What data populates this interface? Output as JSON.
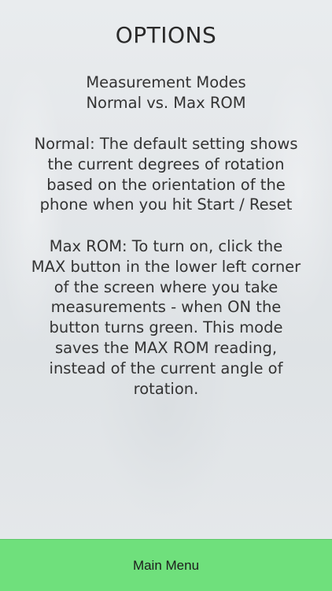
{
  "page": {
    "title": "OPTIONS",
    "modes_heading": "Measurement Modes\nNormal vs. Max ROM",
    "normal_text": "Normal: The default setting shows\nthe current degrees of rotation\nbased on the orientation of the\nphone when you hit Start / Reset",
    "maxrom_text": "Max ROM:  To turn on, click the\nMAX button in the lower left corner\nof the screen where you take\nmeasurements - when ON the\nbutton turns green. This mode\nsaves the MAX ROM reading,\ninstead of the current angle of\nrotation."
  },
  "footer": {
    "main_menu_label": "Main Menu"
  },
  "colors": {
    "footer_bg": "#6fe07c",
    "background": "#e4e7ea"
  }
}
